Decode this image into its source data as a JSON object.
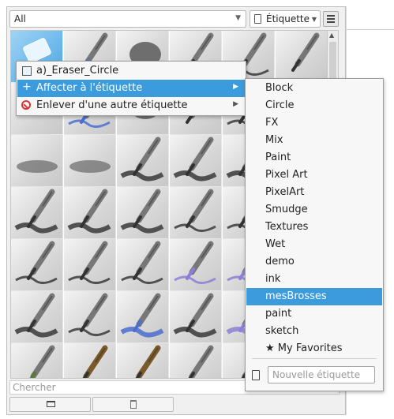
{
  "filter": {
    "value": "All"
  },
  "tag_select": {
    "value": "Étiquette"
  },
  "search": {
    "placeholder": "Chercher"
  },
  "context_menu": {
    "title": "a)_Eraser_Circle",
    "items": [
      {
        "label": "Affecter à l'étiquette",
        "highlighted": true
      },
      {
        "label": "Enlever d'une autre étiquette",
        "highlighted": false
      }
    ]
  },
  "tag_submenu": {
    "items": [
      "Block",
      "Circle",
      "FX",
      "Mix",
      "Paint",
      "Pixel Art",
      "PixelArt",
      "Smudge",
      "Textures",
      "Wet",
      "demo",
      "ink",
      "mesBrosses",
      "paint",
      "sketch",
      "★ My Favorites"
    ],
    "highlighted": "mesBrosses",
    "new_tag_placeholder": "Nouvelle étiquette"
  },
  "brush_grid": {
    "columns": 6,
    "rows": 7,
    "selected_index": 0,
    "tiles": [
      "eraser",
      "marker-blue",
      "smudge-blob",
      "ink-pen",
      "ink-pen-zigzag",
      "ink-pen",
      "eraser",
      "marker-blue",
      "smudge-blob",
      "ink-pen",
      "ink-pen-zigzag",
      "ink-pen",
      "airbrush",
      "airbrush",
      "paintbrush",
      "paintbrush",
      "paintbrush",
      "paintbrush",
      "brush-stroke",
      "brush-stroke",
      "brush-stroke",
      "pen-wave",
      "pen-wave",
      "pen-blue",
      "pencil-grey",
      "pencil-grey",
      "pencil-grey",
      "pencil-purple",
      "pencil-purple",
      "pencil-purple",
      "brush-dark",
      "marker-dark",
      "brush-blue",
      "brush-grey",
      "brush-purple",
      "brush-purple",
      "ink-pen-green",
      "oil-brush",
      "oil-brush",
      "paintbrush",
      "paintbrush",
      "paintbrush"
    ],
    "colors": {
      "selection": "#4aa6e3",
      "highlight": "#3b9bdc"
    }
  }
}
